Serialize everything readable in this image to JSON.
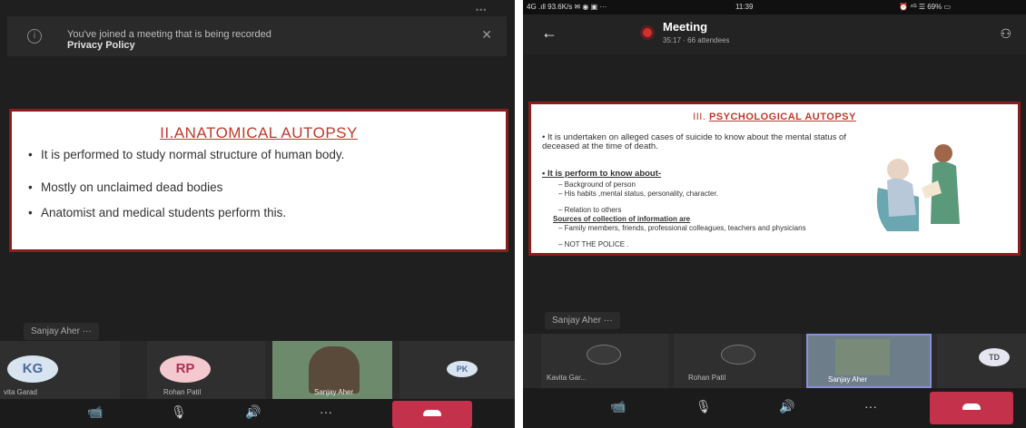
{
  "left": {
    "banner": {
      "line1": "You've joined a meeting that is being recorded",
      "line2": "Privacy Policy",
      "close": "✕",
      "info": "i"
    },
    "top_dots": "•••",
    "slide": {
      "title": "II.ANATOMICAL AUTOPSY",
      "bullets": [
        "It is performed to study normal structure of human body.",
        "Mostly on unclaimed dead bodies",
        "Anatomist and medical students perform this."
      ]
    },
    "presenter_chip": "Sanjay Aher ···",
    "participants": [
      {
        "initials": "KG",
        "name": "vita Garad",
        "color": "#d8e4f0",
        "text_color": "#4a6a9a"
      },
      {
        "initials": "RP",
        "name": "Rohan Patil",
        "color": "#f4c8cf",
        "text_color": "#b03050"
      },
      {
        "initials": "",
        "name": "Sanjay Aher",
        "color": "#6d8a6c",
        "text_color": "#ffffff"
      },
      {
        "initials": "PK",
        "name": "",
        "color": "#d8e4f0",
        "text_color": "#4a6a9a"
      }
    ],
    "controls": {
      "camera": "📹",
      "mic": "🎙",
      "speaker": "🔊",
      "more": "···"
    }
  },
  "right": {
    "status": {
      "left": "4G .ıll 93.6K/s ✉ ◉ ▣ ···",
      "time": "11:39",
      "right": "⏰ ⁴ᴳ ☰ 69% ▭"
    },
    "meeting": {
      "title": "Meeting",
      "sub": "35:17 · 66 attendees",
      "back": "←",
      "people": "⚇"
    },
    "slide": {
      "title_prefix": "III.",
      "title_link": "PSYCHOLOGICAL AUTOPSY",
      "intro": "It is undertaken on alleged cases of suicide to know about the mental status of deceased at the time of death.",
      "head1": "It is perform to know about-",
      "sub1": [
        "Background of person",
        "His habits ,mental status, personality, character.",
        "Relation to others"
      ],
      "head2": "Sources of collection of information are",
      "sub2": [
        "Family members, friends, professional colleagues, teachers and physicians",
        "NOT THE POLICE ."
      ]
    },
    "presenter_chip": "Sanjay Aher ···",
    "participants": [
      {
        "initials": "",
        "name": "Kavita Gar..."
      },
      {
        "initials": "",
        "name": "Rohan Patil"
      },
      {
        "initials": "",
        "name": "Sanjay Aher"
      },
      {
        "initials": "TD",
        "name": ""
      }
    ],
    "controls": {
      "camera": "📹",
      "mic": "🎙",
      "speaker": "🔊",
      "more": "···"
    }
  }
}
